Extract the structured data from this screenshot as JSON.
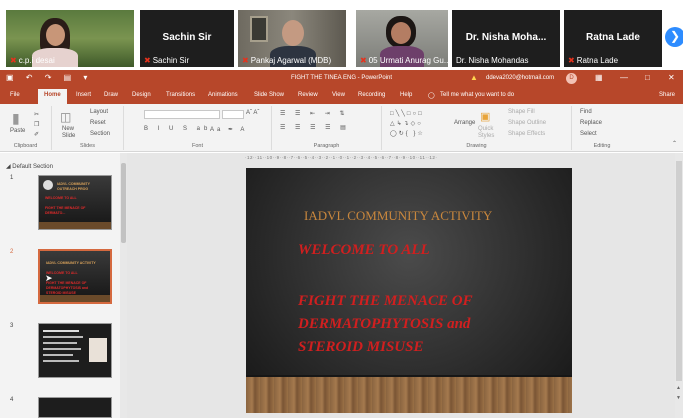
{
  "participants": [
    {
      "name": "c.p.i desai",
      "active": true
    },
    {
      "name": "Sachin Sir",
      "big": "Sachin Sir"
    },
    {
      "name": "Pankaj Agarwal (MDB)"
    },
    {
      "name": "05 Urmati Anurag Gu..."
    },
    {
      "name": "Dr. Nisha Mohandas",
      "big": "Dr. Nisha Moha..."
    },
    {
      "name": "Ratna Lade",
      "big": "Ratna Lade"
    }
  ],
  "app": {
    "title": "FIGHT THE TINEA ENG - PowerPoint",
    "account": "ddeva2020@hotmail.com",
    "avatar": "D",
    "quick_access": "▣ ↶ ↷ ▤ ▾"
  },
  "tabs": [
    "File",
    "Home",
    "Insert",
    "Draw",
    "Design",
    "Transitions",
    "Animations",
    "Slide Show",
    "Review",
    "View",
    "Recording",
    "Help"
  ],
  "tell_me": "Tell me what you want to do",
  "share": "Share",
  "ribbon": {
    "paste": "Paste",
    "new_slide": "New\nSlide",
    "layout": "Layout",
    "reset": "Reset",
    "section": "Section",
    "find": "Find",
    "replace": "Replace",
    "select": "Select",
    "shape_fill": "Shape Fill",
    "shape_outline": "Shape Outline",
    "shape_effects": "Shape Effects",
    "arrange": "Arrange",
    "quick_styles": "Quick\nStyles",
    "groups": {
      "clipboard": "Clipboard",
      "slides": "Slides",
      "font": "Font",
      "paragraph": "Paragraph",
      "drawing": "Drawing",
      "editing": "Editing"
    }
  },
  "left_panel": {
    "section": "Default Section",
    "slides": [
      {
        "num": "1",
        "lines": [
          "IADVL COMMUNITY",
          "OUTREACH PROG",
          "WELCOME TO ALL",
          "FIGHT THE MENACE OF",
          "DERMATO..."
        ]
      },
      {
        "num": "2",
        "lines": [
          "IADVL COMMUNITY ACTIVITY",
          "WELCOME TO ALL",
          "FIGHT THE MENACE OF",
          "DERMATOPHYTOSIS and",
          "STEROID MISUSE"
        ]
      },
      {
        "num": "3"
      },
      {
        "num": "4"
      }
    ]
  },
  "ruler_text": "·12··11··10··9··8··7··6··5··4··3··2··1··0··1··2··3··4··5··6··7··8··9··10··11··12·",
  "slide": {
    "title": "IADVL COMMUNITY ACTIVITY",
    "welcome": "WELCOME TO ALL",
    "line1": "FIGHT THE MENACE OF",
    "line2": "DERMATOPHYTOSIS and",
    "line3": "STEROID MISUSE"
  },
  "colors": {
    "ppt_red": "#b7472a",
    "slide_red": "#d11f1f",
    "slide_gold": "#c9873d"
  }
}
